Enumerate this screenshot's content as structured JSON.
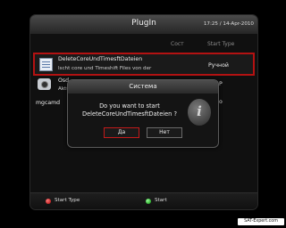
{
  "window": {
    "title": "PlugIn",
    "datetime": "17:25 / 14-Apr-2010"
  },
  "columns": {
    "state": "Сост",
    "start_type": "Start Type"
  },
  "plugins": [
    {
      "name": "DeleteCoreUndTimesftDateien",
      "description": "lscht core und Timeshift Files von der",
      "start_type": "Ручной",
      "icon": "document-icon",
      "selected": true
    },
    {
      "name": "Osd",
      "description": "Aktu",
      "start_type": "P",
      "icon": "camera-icon",
      "selected": false
    },
    {
      "name": "mgcamd",
      "description": "",
      "start_type": "o",
      "icon": "",
      "selected": false
    }
  ],
  "footer": {
    "red_label": "Start Type",
    "green_label": "Start"
  },
  "dialog": {
    "title": "Система",
    "message_line1": "Do you want to start",
    "message_line2": "DeleteCoreUndTimesftDateien ?",
    "yes_label": "Да",
    "no_label": "Нет",
    "icon": "info-icon"
  },
  "watermark": {
    "text": "SAT-Expert.com"
  },
  "colors": {
    "selection_border": "#b31212",
    "red_button": "#cc0000",
    "green_button": "#00aa00"
  }
}
